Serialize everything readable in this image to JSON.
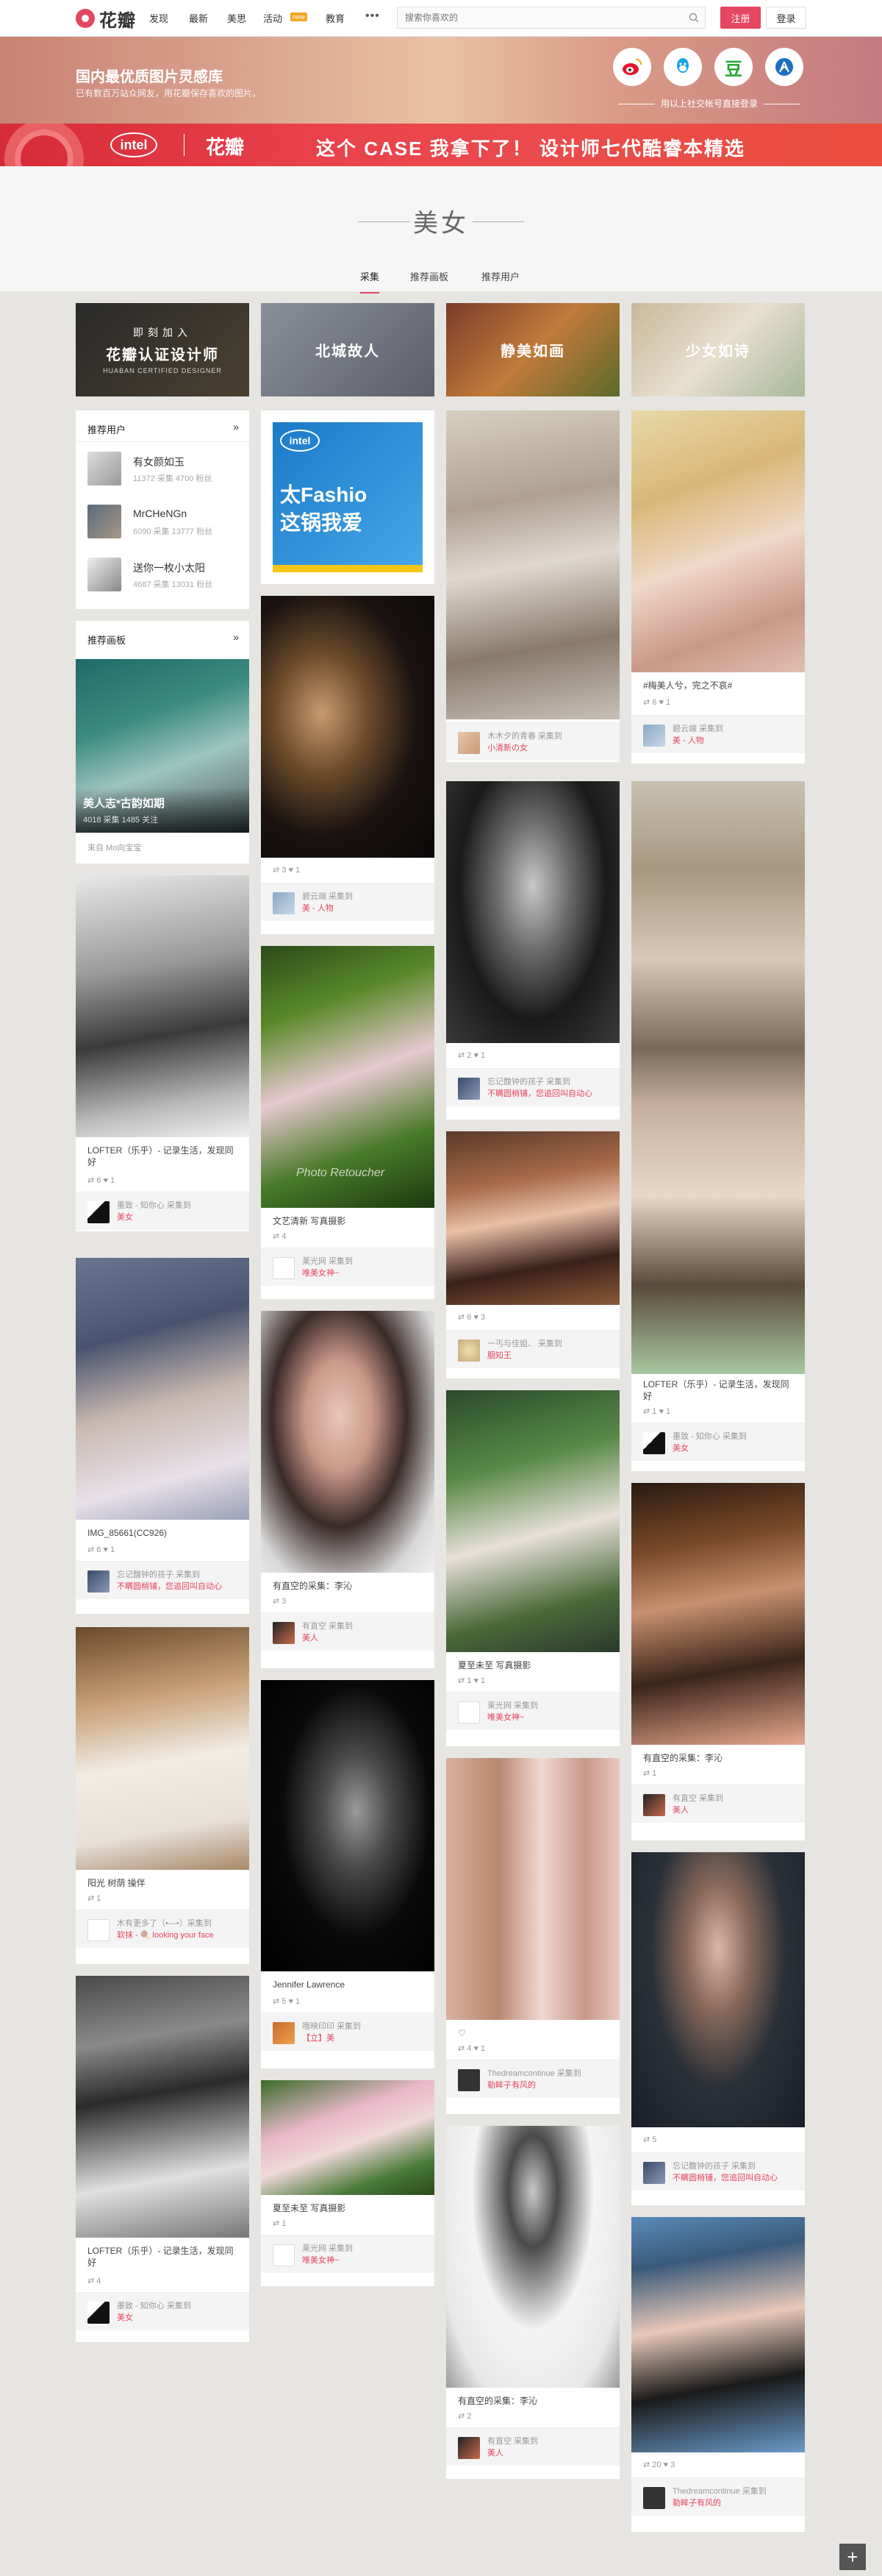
{
  "header": {
    "logo": "花瓣",
    "nav": [
      "发现",
      "最新",
      "美思",
      "活动",
      "教育"
    ],
    "nav_new_tag": "new",
    "more_icon": "more-dots",
    "search_placeholder": "搜索你喜欢的",
    "register": "注册",
    "login": "登录"
  },
  "banner": {
    "headline": "国内最优质图片灵感库",
    "subline": "已有数百万站众网友，用花瓣保存喜欢的图片。",
    "social": [
      "weibo",
      "qq",
      "douban",
      "renren"
    ],
    "douban_glyph": "豆",
    "note": "用以上社交帐号直接登录"
  },
  "ad": {
    "brand": "intel",
    "partner": "花瓣",
    "slogan": "这个 CASE 我拿下了！   设计师七代酷睿本精选"
  },
  "title": "美女",
  "tabs": [
    "采集",
    "推荐画板",
    "推荐用户"
  ],
  "categories": [
    "花瓣认证设计师",
    "北城故人",
    "静美如画",
    "少女如诗"
  ],
  "category_sub": "即刻加入",
  "category_sub2": "HUABAN CERTIFIED DESIGNER",
  "recommend_users": {
    "title": "推荐用户",
    "more": "»",
    "items": [
      {
        "name": "有女颜如玉",
        "meta": "11372 采集   4700 粉丝"
      },
      {
        "name": "MrCHeNGn",
        "meta": "6090 采集   13777 粉丝"
      },
      {
        "name": "送你一枚小太阳",
        "meta": "4687 采集   13031 粉丝"
      }
    ]
  },
  "recommend_boards": {
    "title": "推荐画板",
    "more": "»",
    "board_name": "美人志*古韵如期",
    "board_meta": "4018 采集    1485 关注",
    "from": "来自 Mo向宝宝"
  },
  "pins": {
    "c1": [
      {
        "cap": "LOFTER（乐乎）- 记录生活，发现同好",
        "stat": "6  ♥ 1",
        "user1": "墨致 - 知你心 采集到",
        "user2": "美女"
      },
      {
        "cap": "IMG_85661(CC926)",
        "stat": "6  ♥ 1",
        "user1": "忘记馥钟的孩子 采集到",
        "user2": "不瞒圆梢铺，您追回叫自动心"
      },
      {
        "cap": "阳光 树荫 操伴",
        "stat": "1",
        "user1": "木有更多了（•—•）采集到",
        "user2": "软抹 - 🍭 looking your face"
      },
      {
        "cap": "LOFTER（乐乎）- 记录生活，发现同好",
        "stat": "4",
        "user1": "墨致 - 知你心 采集到",
        "user2": "美女"
      }
    ],
    "c2": [
      {
        "stat": "3  ♥ 1",
        "user1": "碧云端 采集到",
        "user2": "美 - 人物"
      },
      {
        "cap": "文艺清新 写真摄影",
        "stat": "4",
        "user1": "莱光网 采集到",
        "user2": "唯美女神~"
      },
      {
        "cap": "有直空的采集：李沁",
        "stat": "3",
        "user1": "有直空 采集到",
        "user2": "美人"
      },
      {
        "cap": "Jennifer Lawrence",
        "stat": "5  ♥ 1",
        "user1": "哦映印印 采集到",
        "user2": "【立】美"
      },
      {
        "cap": "夏至未至 写真摄影",
        "stat": "1",
        "user1": "莱光网 采集到",
        "user2": "唯美女神~"
      }
    ],
    "c3": [
      {
        "stat": "",
        "user1": "木木夕的青春 采集到",
        "user2": "小清新の女"
      },
      {
        "stat": "2  ♥ 1",
        "user1": "忘记馥钟的孩子 采集到",
        "user2": "不瞒圆梢铺，您追回叫自动心"
      },
      {
        "stat": "6  ♥ 3",
        "user1": "一丐与佳姐、 采集到",
        "user2": "胭知王"
      },
      {
        "cap": "夏至未至 写真摄影",
        "stat": "1  ♥ 1",
        "user1": "莱光网 采集到",
        "user2": "唯美女神~"
      },
      {
        "cap": "♡",
        "stat": "4  ♥ 1",
        "user1": "Thedreamcontinue 采集到",
        "user2": "勒眸子有风的"
      },
      {
        "cap": "有直空的采集：李沁",
        "stat": "2",
        "user1": "有直空 采集到",
        "user2": "美人"
      }
    ],
    "c4": [
      {
        "cap": "#梅美人兮，完之不哀#",
        "stat": "6  ♥ 1",
        "user1": "碧云端 采集到",
        "user2": "美 - 人物"
      },
      {
        "cap": "LOFTER（乐乎）- 记录生活，发现同好",
        "stat": "1  ♥ 1",
        "user1": "墨致 - 知你心 采集到",
        "user2": "美女"
      },
      {
        "cap": "有直空的采集：李沁",
        "stat": "1",
        "user1": "有直空 采集到",
        "user2": "美人"
      },
      {
        "stat": "5",
        "user1": "忘记馥钟的孩子 采集到",
        "user2": "不瞒圆梢铺，您追回叫自动心"
      },
      {
        "stat": "20  ♥ 3",
        "user1": "Thedreamcontinue 采集到",
        "user2": "勒眸子有风的"
      }
    ]
  },
  "intel_ad": {
    "brand": "intel",
    "text": "太Fashio\n这锅我爱"
  },
  "photo_watermark": "Photo Retoucher",
  "back_to_top": "+"
}
